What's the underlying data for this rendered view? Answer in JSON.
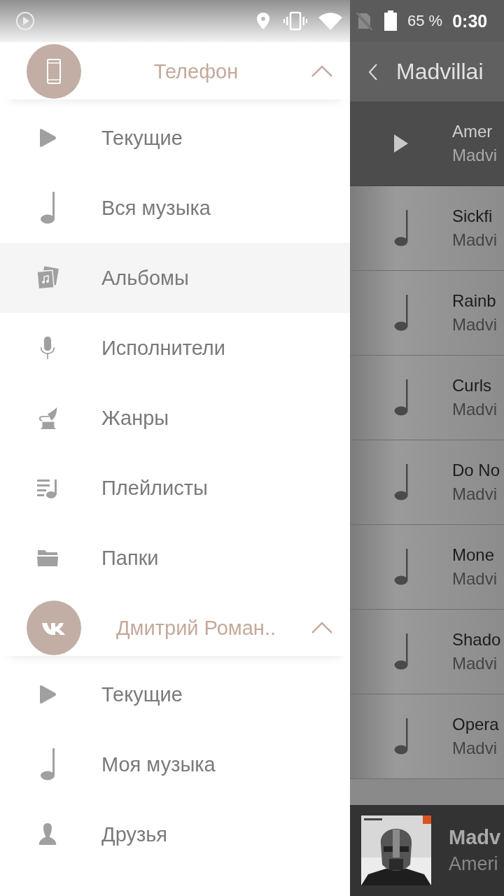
{
  "status_bar": {
    "battery": "65 %",
    "time": "0:30"
  },
  "drawer": {
    "sections": [
      {
        "kind": "phone",
        "title": "Телефон",
        "expanded": true,
        "items": [
          {
            "kind": "play",
            "label": "Текущие",
            "selected": false
          },
          {
            "kind": "note",
            "label": "Вся музыка",
            "selected": false
          },
          {
            "kind": "album",
            "label": "Альбомы",
            "selected": true
          },
          {
            "kind": "mic",
            "label": "Исполнители",
            "selected": false
          },
          {
            "kind": "gramophone",
            "label": "Жанры",
            "selected": false
          },
          {
            "kind": "playlist",
            "label": "Плейлисты",
            "selected": false
          },
          {
            "kind": "folder",
            "label": "Папки",
            "selected": false
          }
        ]
      },
      {
        "kind": "vk",
        "title": "Дмитрий Роман..",
        "expanded": true,
        "items": [
          {
            "kind": "play",
            "label": "Текущие",
            "selected": false
          },
          {
            "kind": "note",
            "label": "Моя музыка",
            "selected": false
          },
          {
            "kind": "person",
            "label": "Друзья",
            "selected": false
          }
        ]
      }
    ]
  },
  "album_view": {
    "title": "Madvillai",
    "tracks": [
      {
        "title": "Amer",
        "artist": "Madvi",
        "playing": true
      },
      {
        "title": "Sickfi",
        "artist": "Madvi",
        "playing": false
      },
      {
        "title": "Rainb",
        "artist": "Madvi",
        "playing": false
      },
      {
        "title": "Curls",
        "artist": "Madvi",
        "playing": false
      },
      {
        "title": "Do No",
        "artist": "Madvi",
        "playing": false
      },
      {
        "title": "Mone",
        "artist": "Madvi",
        "playing": false
      },
      {
        "title": "Shado",
        "artist": "Madvi",
        "playing": false
      },
      {
        "title": "Opera",
        "artist": "Madvi",
        "playing": false
      }
    ]
  },
  "mini_player": {
    "title": "Madv",
    "subtitle": "Ameri"
  }
}
